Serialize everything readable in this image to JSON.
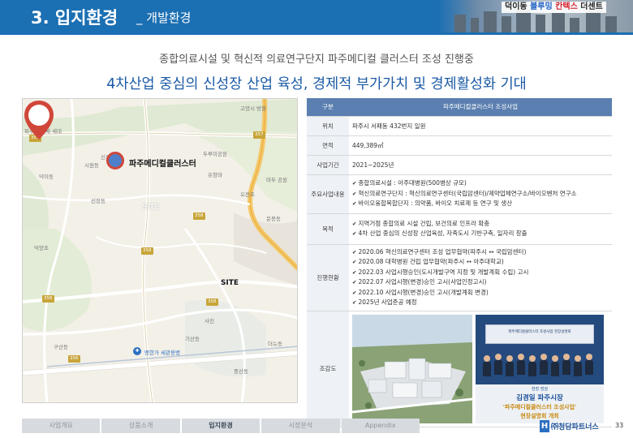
{
  "header": {
    "section_num": "3. 입지환경",
    "section_sub": "_ 개발환경",
    "brand_a": "덕이동 ",
    "brand_b": "블루밍 ",
    "brand_c": "칸텍스 ",
    "brand_d": "더센트"
  },
  "subtitle": "종합의료시설 및 혁신적 의료연구단지 파주메디컬 클러스터 조성 진행중",
  "headline": "4차산업 중심의 신성장 산업 육성, 경제적 부가가치 및 경제활성화 기대",
  "map": {
    "cluster_label": "파주메디컬클러스터",
    "site_pin": "SITE",
    "site_faint": "SITE",
    "landmark": "맨한가 세관용병",
    "route_labels": [
      "357",
      "357",
      "356",
      "358",
      "358",
      "356",
      "358"
    ],
    "place_labels": [
      "파주시 전체 세대",
      "고양시 방향",
      "신도동",
      "덕이동",
      "시원동",
      "두루미공원",
      "마두 공원",
      "유창마",
      "오전초",
      "선장동",
      "덕양초",
      "문봉동",
      "구산동",
      "더뉴동",
      "사진",
      "기산동",
      "중산동"
    ]
  },
  "table": {
    "header_key": "구분",
    "header_val": "파주메디컬클러스터 조성사업",
    "rows": {
      "location_k": "위치",
      "location_v": "파주시 서패동 432번지 일원",
      "area_k": "면적",
      "area_v": "449,389㎡",
      "period_k": "사업기간",
      "period_v": "2021~2025년",
      "main_k": "주요사업내용",
      "main_v": [
        "종합의료시설 : 아주대병원(500병상 규모)",
        "혁신의료연구단지 : 혁신의료연구센터(국립암센터)/제약업체연구소/바이오벤처 연구소",
        "바이오융합복합단지 : 의약품, 바이오 치료제 등 연구 및 생산"
      ],
      "purpose_k": "목적",
      "purpose_v": [
        "지역거점 종합의료 시설 건립, 보건의료 인프라 확충",
        "4차 산업 중심의 신성장 산업육성, 자족도시 기반구축, 일자리 창출"
      ],
      "progress_k": "진행현황",
      "progress_v": [
        "2020.06 혁신의료연구센터 조성 업무협약(파주시 ↔ 국립암센터)",
        "2020.08 대학병원 건립 업무협약(파주시 ↔ 아주대학교)",
        "2022.03 사업시행승인(도시개발구역 지정 및 개발계획 수립) 고시",
        "2022.07 사업시행(변경)승인 고시(사업인정고시)",
        "2022.10 사업시행(변경)승인 고시(개발계획 변경)",
        "2025년 사업준공 예정"
      ],
      "view_k": "조감도"
    },
    "event": {
      "banner": "파주메디컬클러스터 조성사업 현장설명회",
      "cap_small": "현장 점검",
      "cap1": "김경일 파주시장",
      "cap2": "'파주메디컬클러스터 조성사업'",
      "cap3": "현장설명회 개최"
    }
  },
  "footer": {
    "tabs": [
      "사업개요",
      "상품소개",
      "입지환경",
      "시장분석",
      "Appendix"
    ],
    "active_tab": 2,
    "logo_mark": "H",
    "logo_name": "㈜청담파트너스",
    "page": "33"
  },
  "colors": {
    "primary": "#1b6fb3",
    "headline": "#1b5aa6",
    "table_header": "#5a7fb0",
    "pin_red": "#d0473a"
  }
}
